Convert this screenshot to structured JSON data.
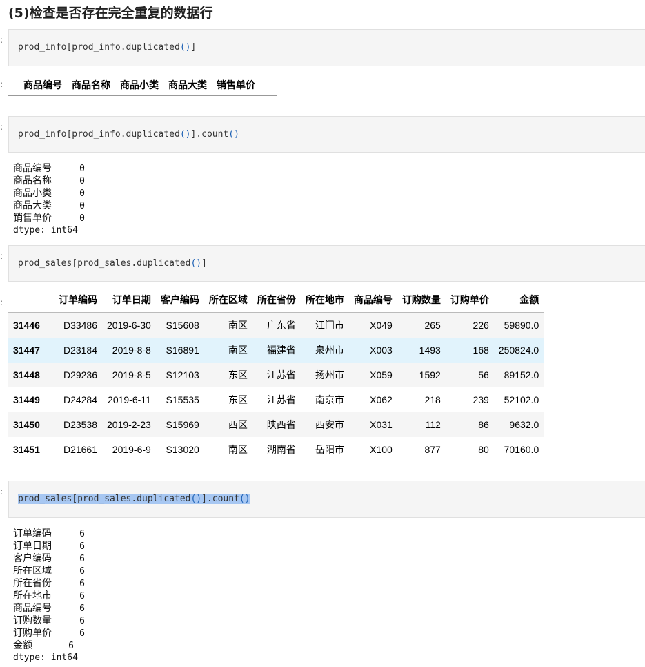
{
  "heading": "(5)检查是否存在完全重复的数据行",
  "cells": {
    "c1": {
      "code_a": "prod_info[prod_info.duplicated",
      "code_b": "()",
      "code_c": "]"
    },
    "c2": {
      "code_a": "prod_info[prod_info.duplicated",
      "code_b": "()",
      "code_c": "].count",
      "code_d": "()"
    },
    "c3": {
      "code_a": "prod_sales[prod_sales.duplicated",
      "code_b": "()",
      "code_c": "]"
    },
    "c4": {
      "code_a": "prod_sales[prod_sales.duplicated",
      "code_b": "()",
      "code_c": "].count",
      "code_d": "()"
    }
  },
  "table1": {
    "columns": [
      "商品编号",
      "商品名称",
      "商品小类",
      "商品大类",
      "销售单价"
    ]
  },
  "output2": {
    "rows": [
      {
        "k": "商品编号",
        "v": "0"
      },
      {
        "k": "商品名称",
        "v": "0"
      },
      {
        "k": "商品小类",
        "v": "0"
      },
      {
        "k": "商品大类",
        "v": "0"
      },
      {
        "k": "销售单价",
        "v": "0"
      }
    ],
    "dtype": "dtype: int64"
  },
  "table2": {
    "columns": [
      "",
      "订单编码",
      "订单日期",
      "客户编码",
      "所在区域",
      "所在省份",
      "所在地市",
      "商品编号",
      "订购数量",
      "订购单价",
      "金额"
    ],
    "rows": [
      [
        "31446",
        "D33486",
        "2019-6-30",
        "S15608",
        "南区",
        "广东省",
        "江门市",
        "X049",
        "265",
        "226",
        "59890.0"
      ],
      [
        "31447",
        "D23184",
        "2019-8-8",
        "S16891",
        "南区",
        "福建省",
        "泉州市",
        "X003",
        "1493",
        "168",
        "250824.0"
      ],
      [
        "31448",
        "D29236",
        "2019-8-5",
        "S12103",
        "东区",
        "江苏省",
        "扬州市",
        "X059",
        "1592",
        "56",
        "89152.0"
      ],
      [
        "31449",
        "D24284",
        "2019-6-11",
        "S15535",
        "东区",
        "江苏省",
        "南京市",
        "X062",
        "218",
        "239",
        "52102.0"
      ],
      [
        "31450",
        "D23538",
        "2019-2-23",
        "S15969",
        "西区",
        "陕西省",
        "西安市",
        "X031",
        "112",
        "86",
        "9632.0"
      ],
      [
        "31451",
        "D21661",
        "2019-6-9",
        "S13020",
        "南区",
        "湖南省",
        "岳阳市",
        "X100",
        "877",
        "80",
        "70160.0"
      ]
    ]
  },
  "output4": {
    "rows": [
      {
        "k": "订单编码",
        "v": "6"
      },
      {
        "k": "订单日期",
        "v": "6"
      },
      {
        "k": "客户编码",
        "v": "6"
      },
      {
        "k": "所在区域",
        "v": "6"
      },
      {
        "k": "所在省份",
        "v": "6"
      },
      {
        "k": "所在地市",
        "v": "6"
      },
      {
        "k": "商品编号",
        "v": "6"
      },
      {
        "k": "订购数量",
        "v": "6"
      },
      {
        "k": "订购单价",
        "v": "6"
      },
      {
        "k": "金额",
        "v": "6"
      }
    ],
    "dtype": "dtype: int64"
  },
  "colors": {
    "highlight_row": "#e1f3fc",
    "selection": "#a7c7f2",
    "cell_bg": "#f5f5f5",
    "paren": "#1a5fb4"
  }
}
